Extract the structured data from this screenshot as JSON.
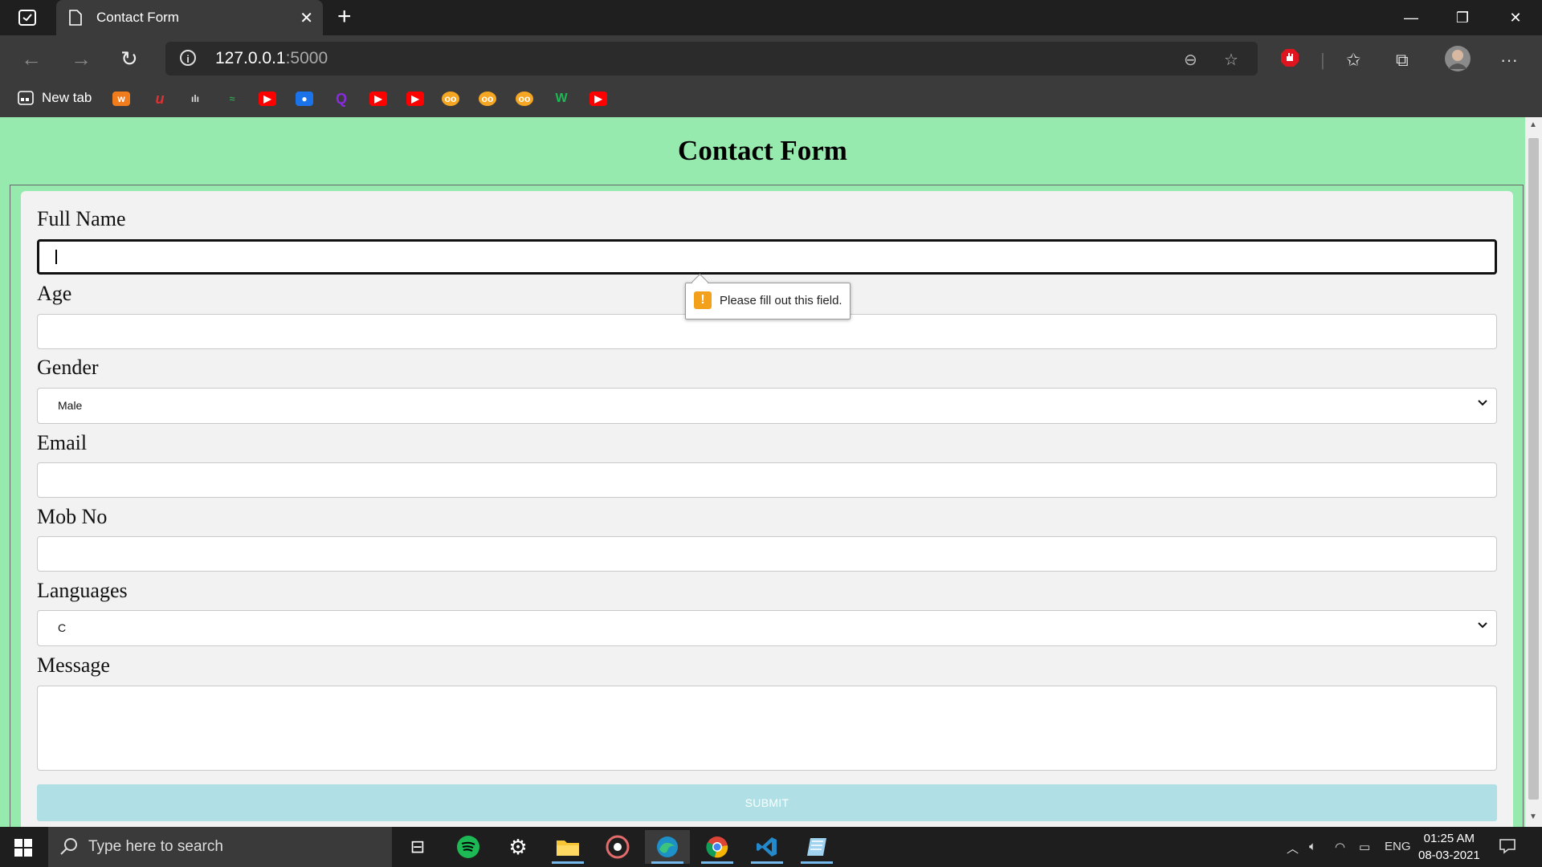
{
  "browser": {
    "tab_title": "Contact Form",
    "url_host": "127.0.0.1",
    "url_port": ":5000",
    "bookmark_newtab_label": "New tab"
  },
  "page": {
    "title": "Contact Form",
    "background_color": "#97eaae",
    "fields": {
      "full_name_label": "Full Name",
      "full_name_value": "",
      "age_label": "Age",
      "age_value": "",
      "gender_label": "Gender",
      "gender_selected": "Male",
      "email_label": "Email",
      "email_value": "",
      "mobile_label": "Mob No",
      "mobile_value": "",
      "languages_label": "Languages",
      "languages_selected": "C",
      "message_label": "Message",
      "message_value": ""
    },
    "submit_label": "SUBMIT",
    "validation_tooltip": "Please fill out this field."
  },
  "taskbar": {
    "search_placeholder": "Type here to search",
    "language": "ENG",
    "time": "01:25 AM",
    "date": "08-03-2021"
  }
}
